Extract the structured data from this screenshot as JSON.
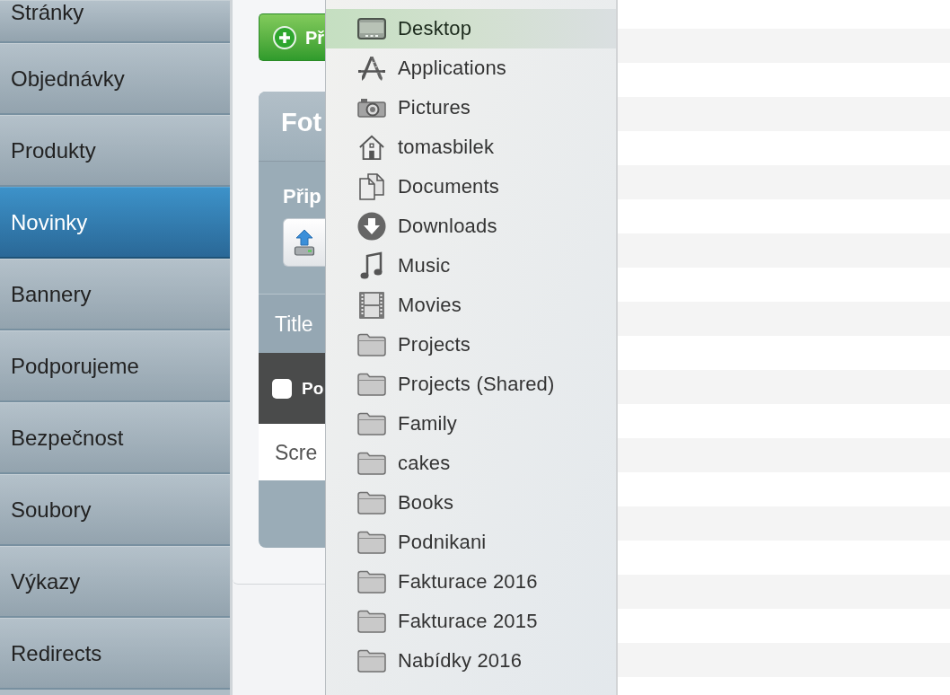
{
  "sidebar": {
    "items": [
      {
        "label": "Stránky",
        "selected": false
      },
      {
        "label": "Objednávky",
        "selected": false
      },
      {
        "label": "Produkty",
        "selected": false
      },
      {
        "label": "Novinky",
        "selected": true
      },
      {
        "label": "Bannery",
        "selected": false
      },
      {
        "label": "Podporujeme",
        "selected": false
      },
      {
        "label": "Bezpečnost",
        "selected": false
      },
      {
        "label": "Soubory",
        "selected": false
      },
      {
        "label": "Výkazy",
        "selected": false
      },
      {
        "label": "Redirects",
        "selected": false
      }
    ]
  },
  "content": {
    "add_button": {
      "label": "Př"
    },
    "panel": {
      "title": "Fot",
      "upload_label": "Přip",
      "table": {
        "header": "Title",
        "group_row": {
          "label": "Po",
          "checked": false
        },
        "rows": [
          {
            "cell": "Scre"
          }
        ]
      }
    }
  },
  "location_menu": {
    "items": [
      {
        "kind": "desktop",
        "label": "Desktop",
        "selected": true
      },
      {
        "kind": "applications",
        "label": "Applications",
        "selected": false
      },
      {
        "kind": "pictures",
        "label": "Pictures",
        "selected": false
      },
      {
        "kind": "home",
        "label": "tomasbilek",
        "selected": false
      },
      {
        "kind": "documents",
        "label": "Documents",
        "selected": false
      },
      {
        "kind": "downloads",
        "label": "Downloads",
        "selected": false
      },
      {
        "kind": "music",
        "label": "Music",
        "selected": false
      },
      {
        "kind": "movies",
        "label": "Movies",
        "selected": false
      },
      {
        "kind": "folder",
        "label": "Projects",
        "selected": false
      },
      {
        "kind": "folder",
        "label": "Projects (Shared)",
        "selected": false
      },
      {
        "kind": "folder",
        "label": "Family",
        "selected": false
      },
      {
        "kind": "folder",
        "label": "cakes",
        "selected": false
      },
      {
        "kind": "folder",
        "label": "Books",
        "selected": false
      },
      {
        "kind": "folder",
        "label": "Podnikani",
        "selected": false
      },
      {
        "kind": "folder",
        "label": "Fakturace 2016",
        "selected": false
      },
      {
        "kind": "folder",
        "label": "Fakturace 2015",
        "selected": false
      },
      {
        "kind": "folder",
        "label": "Nabídky 2016",
        "selected": false
      }
    ]
  }
}
